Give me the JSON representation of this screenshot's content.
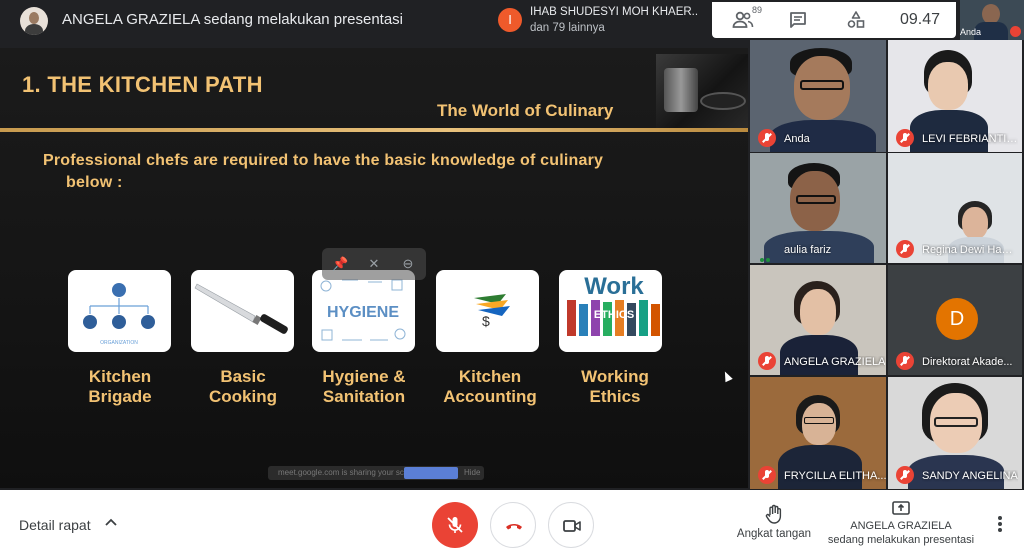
{
  "topbar": {
    "presenting_text": "ANGELA GRAZIELA sedang melakukan presentasi",
    "notification": {
      "avatar_letter": "I",
      "line1": "IHAB SHUDESYI MOH KHAER...",
      "line2": "dan 79 lainnya"
    },
    "participants_count": "89",
    "clock": "09.47",
    "self_label": "Anda"
  },
  "slide": {
    "title": "1. THE KITCHEN PATH",
    "subtitle": "The World of Culinary",
    "intro_line1": "Professional chefs are required to have the basic knowledge of culinary",
    "intro_line2": "below :",
    "cards": [
      {
        "label_1": "Kitchen",
        "label_2": "Brigade",
        "image_text": "ORGANIZATION"
      },
      {
        "label_1": "Basic",
        "label_2": "Cooking"
      },
      {
        "label_1": "Hygiene &",
        "label_2": "Sanitation",
        "image_text": "HYGIENE"
      },
      {
        "label_1": "Kitchen",
        "label_2": "Accounting"
      },
      {
        "label_1": "Working",
        "label_2": "Ethics",
        "image_text_1": "Work",
        "image_text_2": "ETHICS"
      }
    ],
    "share_notice": "meet.google.com is sharing your screen.",
    "share_stop": "Stop sharing",
    "share_hide": "Hide"
  },
  "participants": [
    {
      "name": "Anda"
    },
    {
      "name": "LEVI FEBRIANTI ..."
    },
    {
      "name": "aulia fariz"
    },
    {
      "name": "Regina Dewi Hani..."
    },
    {
      "name": "ANGELA GRAZIELA"
    },
    {
      "name": "Direktorat Akade...",
      "avatar_letter": "D"
    },
    {
      "name": "FRYCILLA ELITHA..."
    },
    {
      "name": "SANDY ANGELINA"
    }
  ],
  "bottombar": {
    "details_label": "Detail rapat",
    "raise_hand_label": "Angkat tangan",
    "present_line1": "ANGELA GRAZIELA",
    "present_line2": "sedang melakukan presentasi"
  },
  "colors": {
    "slide_gold": "#f2c273",
    "mic_off_red": "#ea4335",
    "avatar_orange": "#e37400"
  }
}
